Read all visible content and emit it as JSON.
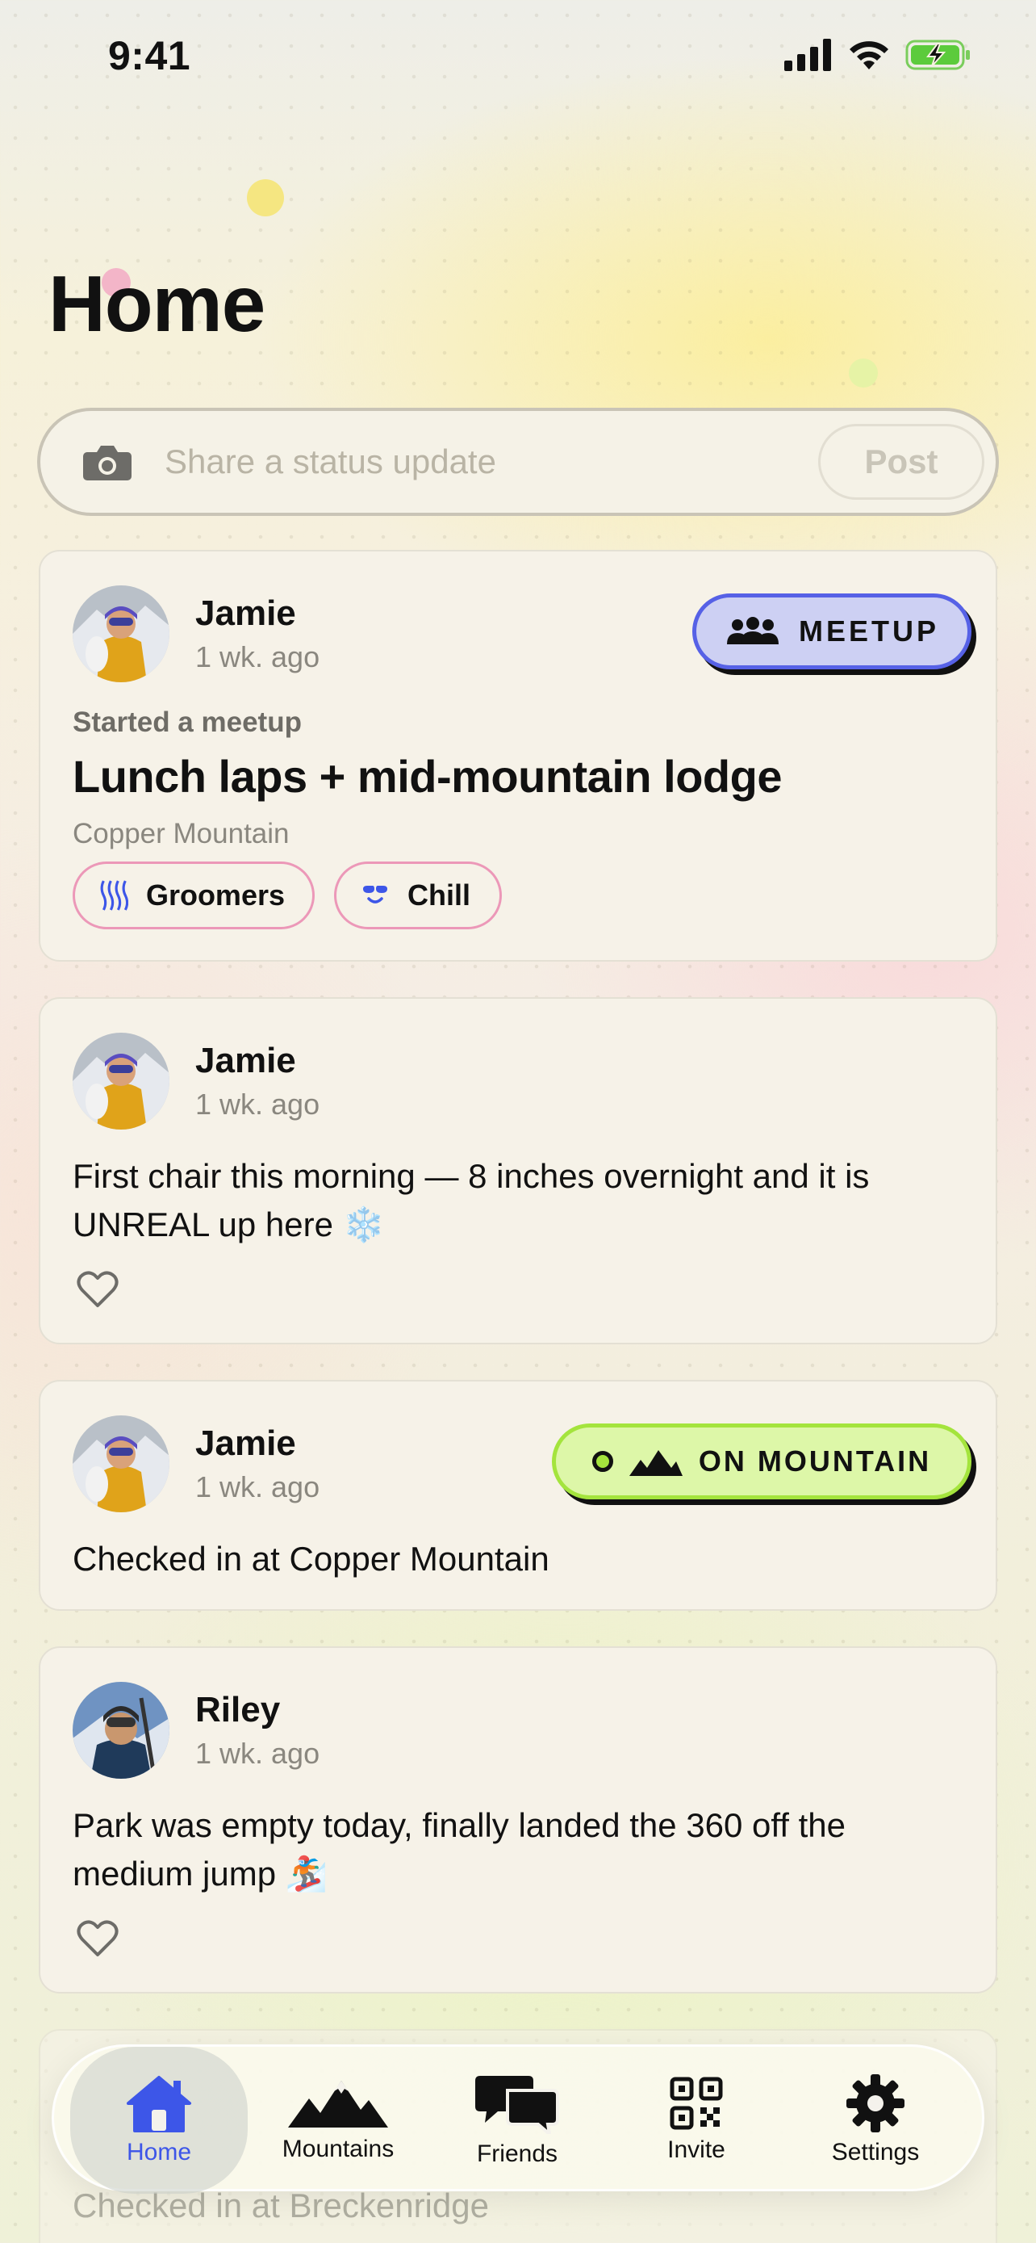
{
  "status_bar": {
    "time": "9:41"
  },
  "page": {
    "title": "Home"
  },
  "composer": {
    "placeholder": "Share a status update",
    "post_label": "Post"
  },
  "feed": [
    {
      "user": "Jamie",
      "time": "1 wk. ago",
      "badge": "MEETUP",
      "subtitle": "Started a meetup",
      "title": "Lunch laps + mid-mountain lodge",
      "location": "Copper Mountain",
      "tags": [
        "Groomers",
        "Chill"
      ]
    },
    {
      "user": "Jamie",
      "time": "1 wk. ago",
      "text": "First chair this morning — 8 inches overnight and it is UNREAL up here ❄️"
    },
    {
      "user": "Jamie",
      "time": "1 wk. ago",
      "badge": "ON MOUNTAIN",
      "text": "Checked in at Copper Mountain"
    },
    {
      "user": "Riley",
      "time": "1 wk. ago",
      "text": "Park was empty today, finally landed the 360 off the medium jump 🏂"
    },
    {
      "text": "Checked in at Breckenridge"
    }
  ],
  "tabbar": {
    "tabs": [
      {
        "label": "Home",
        "icon": "home-icon",
        "active": true
      },
      {
        "label": "Mountains",
        "icon": "mountains-icon"
      },
      {
        "label": "Friends",
        "icon": "chat-bubbles-icon"
      },
      {
        "label": "Invite",
        "icon": "qr-code-icon"
      },
      {
        "label": "Settings",
        "icon": "gear-icon"
      }
    ]
  },
  "colors": {
    "accent": "#3d56e8",
    "meetup_badge_bg": "#cdd0f3",
    "meetup_badge_border": "#5661e6",
    "mountain_badge_bg": "#ddf7a8",
    "mountain_badge_border": "#a4e43d",
    "tag_border": "#ec98b8",
    "card_bg": "#f6f2e8"
  }
}
